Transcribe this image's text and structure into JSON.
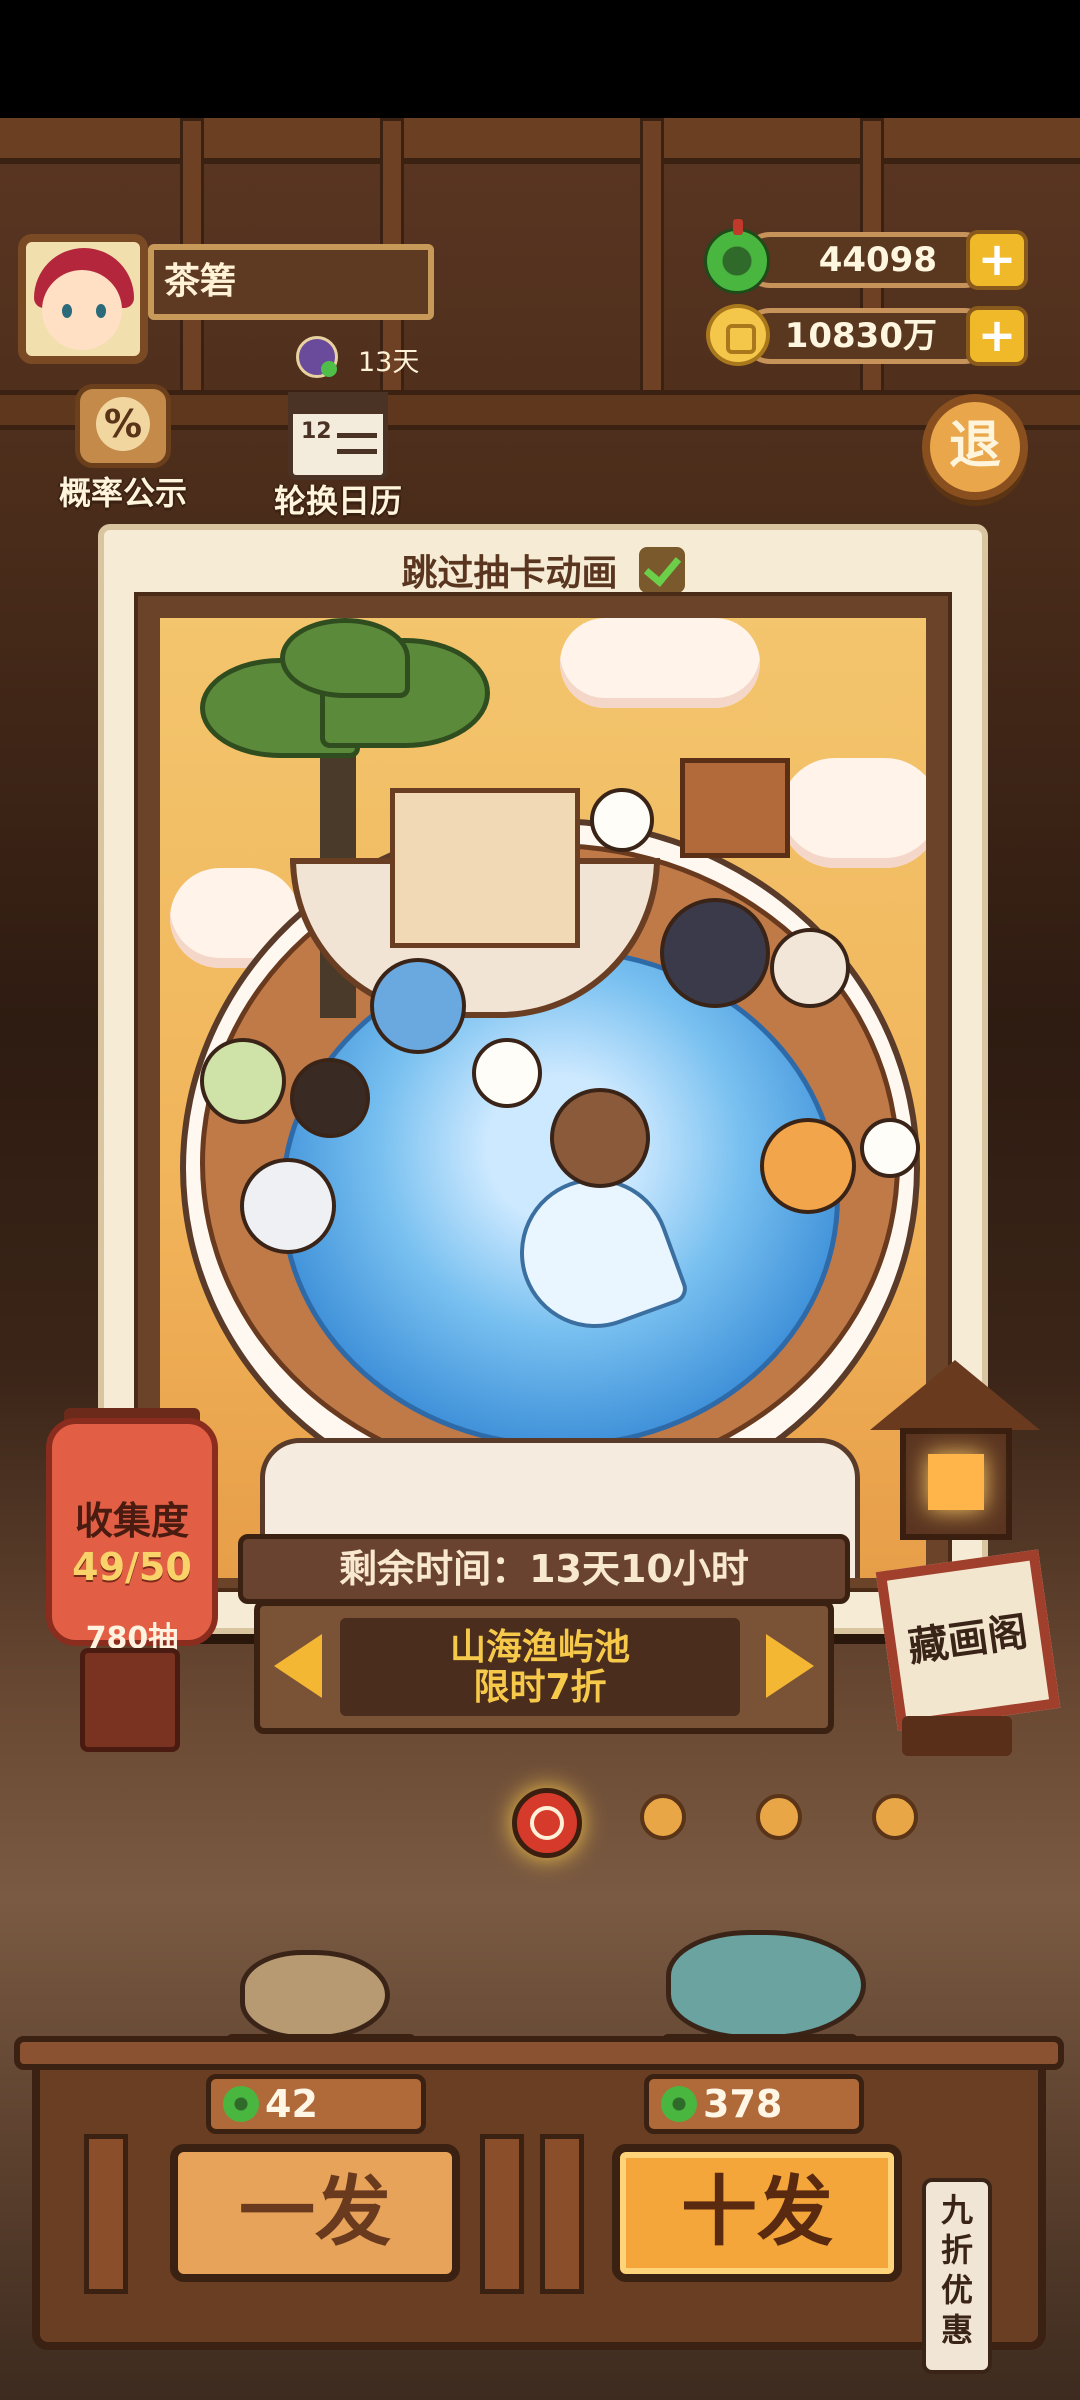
{
  "player": {
    "name": "茶箬",
    "days_label": "13天"
  },
  "currency": {
    "jade": "44098",
    "coins": "10830万",
    "plus": "+"
  },
  "top_buttons": {
    "probability": "概率公示",
    "probability_symbol": "%",
    "calendar": "轮换日历",
    "calendar_num": "12",
    "exit": "退"
  },
  "banner": {
    "skip_animation": "跳过抽卡动画",
    "skip_checked": true
  },
  "pool": {
    "time_left": "剩余时间：13天10小时",
    "name": "山海渔屿池",
    "discount": "限时7折"
  },
  "collection": {
    "title": "收集度",
    "progress": "49/50",
    "draws": "780抽"
  },
  "gallery": {
    "label": "藏画阁"
  },
  "page_dots": {
    "count": 4,
    "active_index": 0
  },
  "draw": {
    "single": {
      "label": "一发",
      "cost": "42"
    },
    "ten": {
      "label": "十发",
      "cost": "378"
    },
    "discount_tag": "九折优惠"
  },
  "colors": {
    "accent": "#f4b733",
    "wood": "#6a3e22",
    "jade": "#49b63f"
  }
}
